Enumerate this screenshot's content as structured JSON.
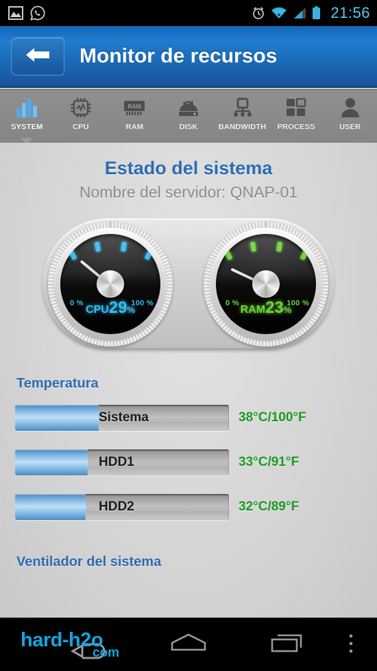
{
  "statusbar": {
    "time": "21:56",
    "left_icons": [
      "image-icon",
      "whatsapp-icon"
    ],
    "right_icons": [
      "alarm-icon",
      "wifi-icon",
      "signal-icon",
      "battery-icon"
    ],
    "accent_color": "#5fc8ef"
  },
  "header": {
    "title": "Monitor de recursos",
    "back_label": "back-arrow",
    "bg_color": "#1a63ad"
  },
  "tabs": [
    {
      "label": "SYSTEM",
      "icon": "bar-chart-icon",
      "active": true
    },
    {
      "label": "CPU",
      "icon": "cpu-chip-icon",
      "active": false
    },
    {
      "label": "RAM",
      "icon": "ram-stick-icon",
      "active": false
    },
    {
      "label": "DISK",
      "icon": "hard-disk-icon",
      "active": false
    },
    {
      "label": "BANDWIDTH",
      "icon": "network-icon",
      "active": false
    },
    {
      "label": "PROCESS",
      "icon": "grid-squares-icon",
      "active": false
    },
    {
      "label": "USER",
      "icon": "person-icon",
      "active": false
    }
  ],
  "main": {
    "section_title": "Estado del sistema",
    "server_label": "Nombre del servidor: QNAP-01",
    "title_color": "#2c6cb0"
  },
  "chart_data": {
    "type": "gauge",
    "title": "Estado del sistema",
    "gauges": [
      {
        "name": "CPU",
        "value": 29,
        "unit": "%",
        "value_text": "29",
        "pct_symbol": "%",
        "min_label": "0 %",
        "max_label": "100 %",
        "range": [
          0,
          100
        ],
        "color": "#35bdf0",
        "warn_color": "#e4003c",
        "warn_from": 79,
        "dash_count": 14
      },
      {
        "name": "RAM",
        "value": 23,
        "unit": "%",
        "value_text": "23",
        "pct_symbol": "%",
        "min_label": "0 %",
        "max_label": "100 %",
        "range": [
          0,
          100
        ],
        "color": "#6ed43a",
        "warn_color": "#e4003c",
        "warn_from": 79,
        "dash_count": 14
      }
    ],
    "temperature": {
      "title": "Temperatura",
      "unit_c": "°C",
      "unit_f": "°F",
      "rows": [
        {
          "label": "Sistema",
          "value_text": "38°C/100°F",
          "celsius": 38,
          "fahrenheit": 100,
          "percent": 39
        },
        {
          "label": "HDD1",
          "value_text": "33°C/91°F",
          "celsius": 33,
          "fahrenheit": 91,
          "percent": 34
        },
        {
          "label": "HDD2",
          "value_text": "32°C/89°F",
          "celsius": 32,
          "fahrenheit": 89,
          "percent": 33
        }
      ],
      "value_color": "#189a20"
    },
    "fan": {
      "title": "Ventilador del sistema"
    }
  },
  "navbar": {
    "watermark_main": "hard-h2o",
    "watermark_suffix": "com",
    "watermark_color": "#12a5dd",
    "buttons": [
      "back-icon",
      "home-icon",
      "recents-icon",
      "menu-icon"
    ]
  }
}
